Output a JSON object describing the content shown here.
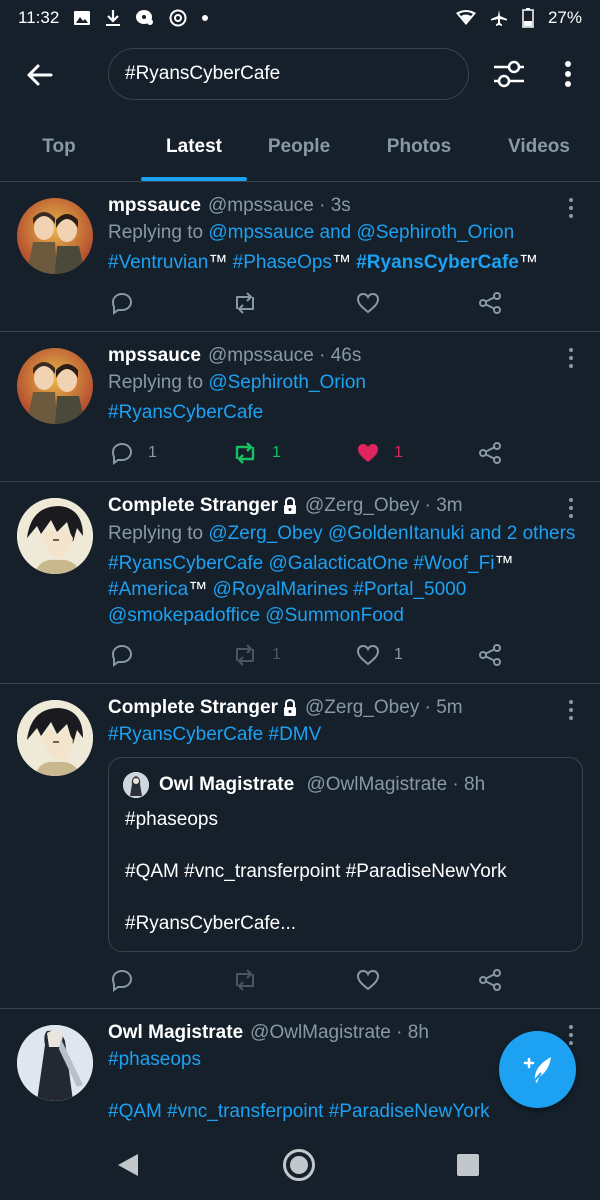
{
  "status_bar": {
    "time": "11:32",
    "battery": "27%"
  },
  "search": {
    "query": "#RyansCyberCafe"
  },
  "tabs": [
    {
      "label": "Top"
    },
    {
      "label": "Latest"
    },
    {
      "label": "People"
    },
    {
      "label": "Photos"
    },
    {
      "label": "Videos"
    }
  ],
  "active_tab": "Latest",
  "tweets": [
    {
      "name": "mpssauce",
      "handle": "@mpssauce · 3s",
      "reply_prefix": "Replying to ",
      "reply_to": "@mpssauce and @Sephiroth_Orion",
      "body": {
        "p1": "#Ventruvian",
        "p2": "™ ",
        "p3": "#PhaseOps",
        "p4": "™ ",
        "p5": "#RyansCyberCafe",
        "p6": "™"
      },
      "reply_count": "",
      "retweet_count": "",
      "like_count": ""
    },
    {
      "name": "mpssauce",
      "handle": "@mpssauce · 46s",
      "reply_prefix": "Replying to ",
      "reply_to": "@Sephiroth_Orion",
      "body": {
        "p1": "#RyansCyberCafe"
      },
      "reply_count": "1",
      "retweet_count": "1",
      "like_count": "1"
    },
    {
      "name": "Complete Stranger",
      "handle": "@Zerg_Obey · 3m",
      "reply_prefix": "Replying to ",
      "reply_to": "@Zerg_Obey @GoldenItanuki and 2 others",
      "body": {
        "l1a": "#RyansCyberCafe @GalacticatOne #Woof_Fi",
        "l1b": "™",
        "l2a": "#America",
        "l2b": "™ ",
        "l2c": "@RoyalMarines #Portal_5000",
        "l3a": "@smokepadoffice @SummonFood"
      },
      "reply_count": "",
      "retweet_count": "1",
      "like_count": "1"
    },
    {
      "name": "Complete Stranger",
      "handle": "@Zerg_Obey · 5m",
      "body": {
        "p1": "#RyansCyberCafe #DMV"
      },
      "quote": {
        "name": "Owl Magistrate",
        "handle": "@OwlMagistrate · 8h",
        "line1": "#phaseops",
        "line2": "#QAM #vnc_transferpoint #ParadiseNewYork",
        "line3": "#RyansCyberCafe..."
      }
    },
    {
      "name": "Owl Magistrate",
      "handle": "@OwlMagistrate · 8h",
      "body": {
        "p1": "#phaseops",
        "p2": "#QAM #vnc_transferpoint #ParadiseNewYork"
      }
    }
  ],
  "colors": {
    "background": "#15202b",
    "accent": "#1da1f2",
    "muted": "#8899a6",
    "border": "#38444d",
    "retweet_active": "#17bf63",
    "like_active": "#e0245e"
  },
  "icons": [
    "back-arrow-icon",
    "filter-sliders-icon",
    "more-vertical-icon",
    "reply-icon",
    "retweet-icon",
    "like-icon",
    "share-icon",
    "compose-icon",
    "lock-icon"
  ]
}
